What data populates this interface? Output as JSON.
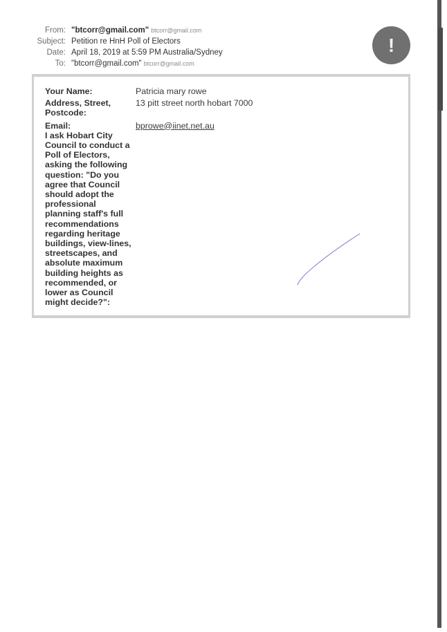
{
  "email_header": {
    "from": {
      "label": "From:",
      "name": "\"btcorr@gmail.com\"",
      "address": "btcorr@gmail.com"
    },
    "subject": {
      "label": "Subject:",
      "value": "Petition re HnH Poll of Electors"
    },
    "date": {
      "label": "Date:",
      "value": "April 18, 2019 at 5:59 PM Australia/Sydney"
    },
    "to": {
      "label": "To:",
      "name": "\"btcorr@gmail.com\"",
      "address": "btcorr@gmail.com"
    },
    "priority_icon": "exclamation-icon",
    "priority_symbol": "!"
  },
  "form": {
    "fields": [
      {
        "label": "Your Name:",
        "value": "Patricia mary rowe"
      },
      {
        "label": "Address, Street, Postcode:",
        "value": "13 pitt street north hobart 7000"
      },
      {
        "label": "Email:",
        "value": "bprowe@iinet.net.au"
      },
      {
        "label": "I ask Hobart City Council to conduct a Poll of Electors, asking the following question: \"Do you agree that Council should adopt the professional planning staff's full recommendations regarding heritage buildings, view-lines, streetscapes, and absolute maximum building heights as recommended, or lower as Council might decide?\":",
        "value": ""
      }
    ]
  },
  "colors": {
    "label_gray": "#6d6d6d",
    "text": "#333333",
    "frame_border": "#d0d0d0",
    "alert_circle": "#707070",
    "pen_stroke": "#5a5fc8",
    "edge_line": "#555555"
  }
}
